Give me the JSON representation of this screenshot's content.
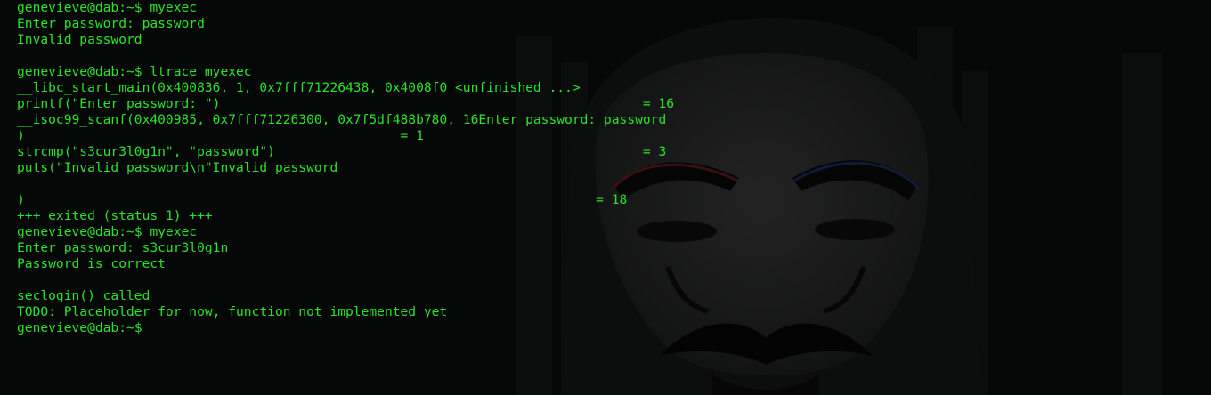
{
  "terminal": {
    "lines": [
      "genevieve@dab:~$ myexec",
      "Enter password: password",
      "Invalid password",
      "",
      "genevieve@dab:~$ ltrace myexec",
      "__libc_start_main(0x400836, 1, 0x7fff71226438, 0x4008f0 <unfinished ...>",
      "printf(\"Enter password: \")                                                      = 16",
      "__isoc99_scanf(0x400985, 0x7fff71226300, 0x7f5df488b780, 16Enter password: password",
      ")                                                = 1",
      "strcmp(\"s3cur3l0g1n\", \"password\")                                               = 3",
      "puts(\"Invalid password\\n\"Invalid password",
      "",
      ")                                                                         = 18",
      "+++ exited (status 1) +++",
      "genevieve@dab:~$ myexec",
      "Enter password: s3cur3l0g1n",
      "Password is correct",
      "",
      "seclogin() called",
      "TODO: Placeholder for now, function not implemented yet",
      "genevieve@dab:~$ "
    ]
  },
  "colors": {
    "text": "#29e429",
    "background": "#050606",
    "wallpaper_mask": "#1a1a1a"
  },
  "wallpaper": {
    "icon": "fsociety-mask-icon"
  }
}
